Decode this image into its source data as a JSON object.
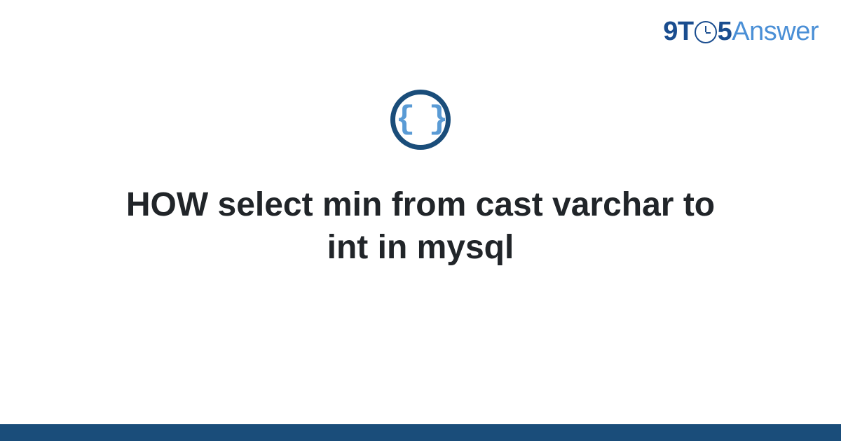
{
  "logo": {
    "nine": "9",
    "t": "T",
    "five": "5",
    "answer": "Answer"
  },
  "icon": {
    "braces": "{ }"
  },
  "title": "HOW select min from cast varchar to int in mysql"
}
